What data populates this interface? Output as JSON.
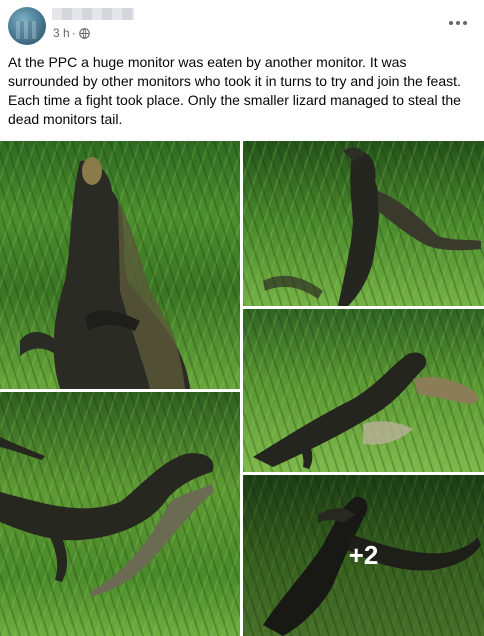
{
  "post": {
    "author_name": "",
    "time": "3 h",
    "separator": "·",
    "privacy_icon": "globe-icon",
    "more_icon": "more-horizontal-icon",
    "text": "At the PPC a huge monitor was eaten by another monitor. It was surrounded by other monitors who took it in turns to try and join the feast. Each time a fight took place. Only the smaller lizard managed to steal the dead monitors tail."
  },
  "photos": {
    "extra_count_label": "+2",
    "items": [
      {
        "subject": "monitor-lizard-upright"
      },
      {
        "subject": "monitor-lizard-walking"
      },
      {
        "subject": "two-monitors-fighting"
      },
      {
        "subject": "monitors-eating"
      },
      {
        "subject": "monitors-wrestling"
      }
    ]
  },
  "colors": {
    "text": "#050505",
    "secondary_text": "#65676b",
    "overlay_text": "#ffffff"
  }
}
